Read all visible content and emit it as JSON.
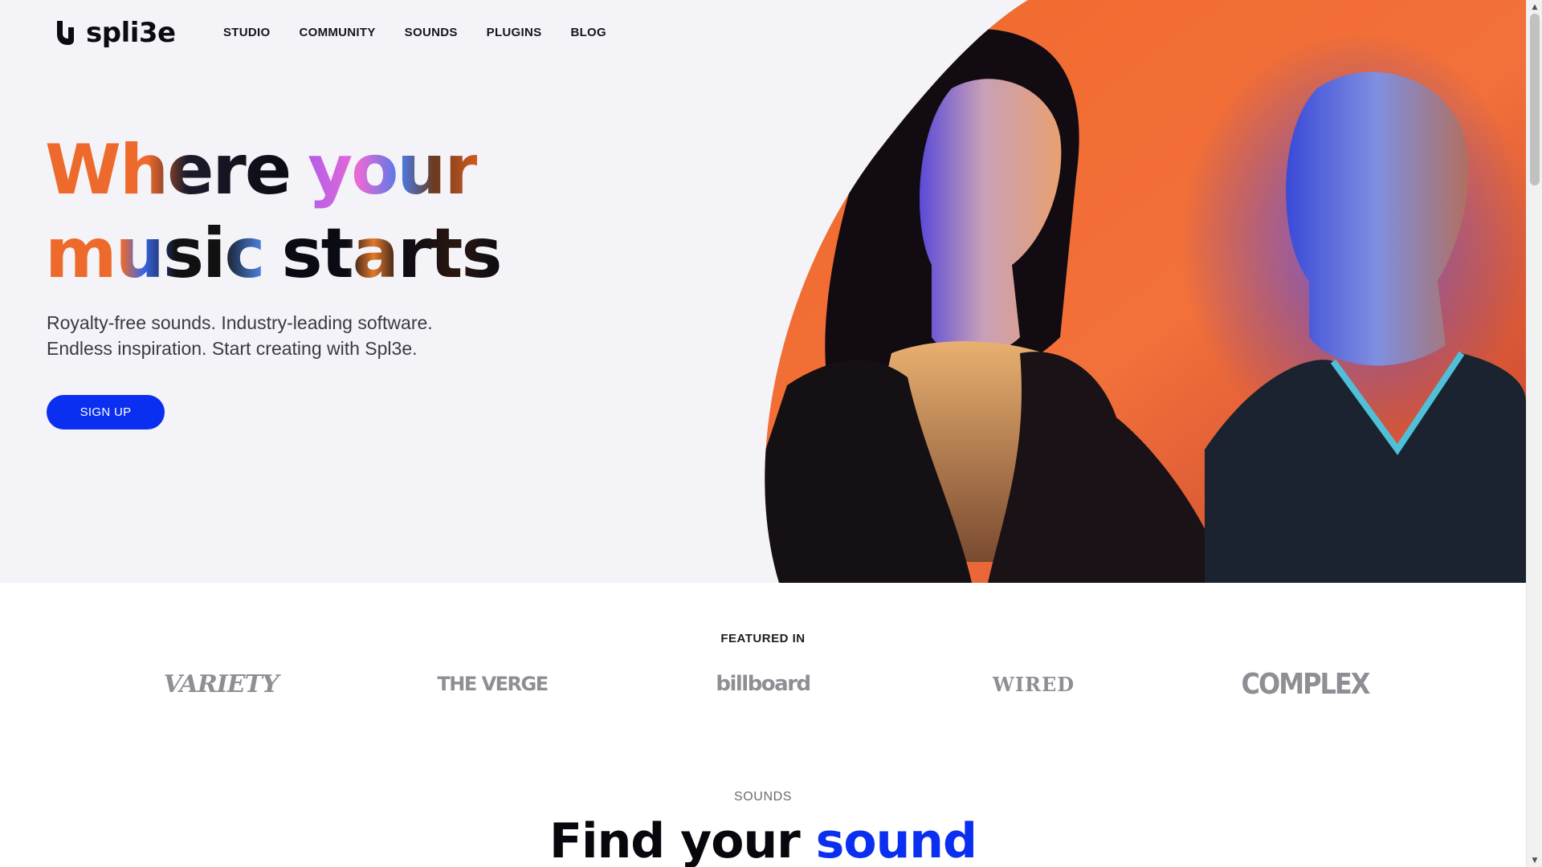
{
  "brand": {
    "name": "spli3e",
    "logo_icon": "splice-logo-icon"
  },
  "nav": {
    "items": [
      {
        "label": "STUDIO"
      },
      {
        "label": "COMMUNITY"
      },
      {
        "label": "SOUNDS"
      },
      {
        "label": "PLUGINS"
      },
      {
        "label": "BLOG"
      }
    ]
  },
  "hero": {
    "headline": {
      "line1": [
        "Where",
        "your"
      ],
      "line2": [
        "music",
        "starts"
      ]
    },
    "subtext": {
      "line1": "Royalty-free sounds. Industry-leading software.",
      "line2": "Endless inspiration. Start creating with Spl3e."
    },
    "cta_label": "SIGN UP",
    "photo": "two-people-orange-background-photo"
  },
  "featured": {
    "label": "FEATURED IN",
    "logos": [
      "VARIETY",
      "THE VERGE",
      "billboard",
      "WIRED",
      "COMPLEX"
    ]
  },
  "sounds": {
    "label": "SOUNDS",
    "title_start": "Find your",
    "title_accent": "sound"
  },
  "colors": {
    "accent_blue": "#0a2ff0",
    "hero_orange": "#ee6a2c",
    "hero_bg": "#f3f3f8",
    "text_dark": "#0b0b14",
    "logo_gray": "#8e8e94"
  }
}
